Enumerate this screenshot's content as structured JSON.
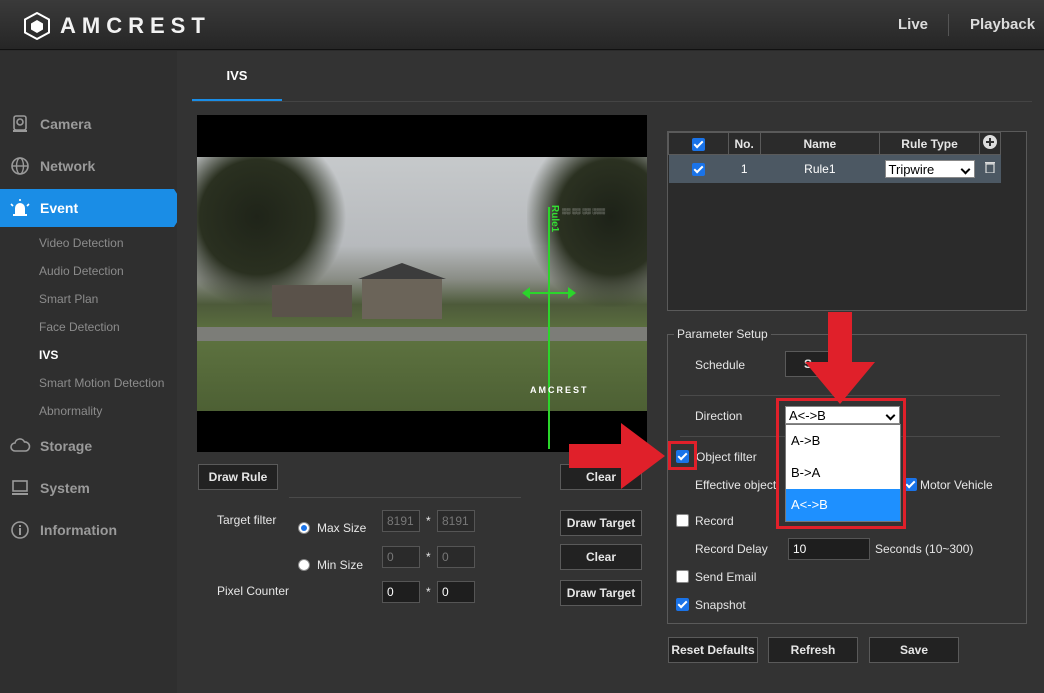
{
  "header": {
    "brand": "AMCREST",
    "nav_live": "Live",
    "nav_playback": "Playback"
  },
  "sidebar": {
    "items": [
      {
        "label": "Camera",
        "icon": "camera-icon"
      },
      {
        "label": "Network",
        "icon": "globe-icon"
      },
      {
        "label": "Event",
        "icon": "alarm-icon"
      },
      {
        "label": "Storage",
        "icon": "cloud-icon"
      },
      {
        "label": "System",
        "icon": "monitor-icon"
      },
      {
        "label": "Information",
        "icon": "info-icon"
      }
    ],
    "event_subitems": [
      "Video Detection",
      "Audio Detection",
      "Smart Plan",
      "Face Detection",
      "IVS",
      "Smart Motion Detection",
      "Abnormality"
    ],
    "active_subitem": "IVS"
  },
  "tab": {
    "label": "IVS"
  },
  "video": {
    "rule_label": "Rule1",
    "watermark": "AMCREST"
  },
  "controls": {
    "draw_rule": "Draw Rule",
    "clear": "Clear",
    "draw_target": "Draw Target",
    "target_filter_label": "Target filter",
    "max_size_label": "Max Size",
    "min_size_label": "Min Size",
    "max_w": "8191",
    "max_h": "8191",
    "min_w": "0",
    "min_h": "0",
    "times": "*",
    "pixel_counter_label": "Pixel Counter",
    "pc_w": "0",
    "pc_h": "0"
  },
  "rules_table": {
    "headers": [
      "No.",
      "Name",
      "Rule Type"
    ],
    "rows": [
      {
        "no": "1",
        "name": "Rule1",
        "rule_type": "Tripwire"
      }
    ]
  },
  "param": {
    "title": "Parameter Setup",
    "schedule_label": "Schedule",
    "schedule_btn": "S",
    "direction_label": "Direction",
    "direction_value": "A<->B",
    "direction_options": [
      "A->B",
      "B->A",
      "A<->B"
    ],
    "object_filter_label": "Object filter",
    "effective_object_label": "Effective object",
    "motor_vehicle_label": "Motor Vehicle",
    "record_label": "Record",
    "record_delay_label": "Record Delay",
    "record_delay_value": "10",
    "record_delay_unit": "Seconds (10~300)",
    "send_email_label": "Send Email",
    "snapshot_label": "Snapshot"
  },
  "footer_buttons": {
    "reset": "Reset Defaults",
    "refresh": "Refresh",
    "save": "Save"
  },
  "colors": {
    "accent": "#1a8de6",
    "annotation_red": "#e0202a",
    "rule_line": "#2bd52b"
  }
}
